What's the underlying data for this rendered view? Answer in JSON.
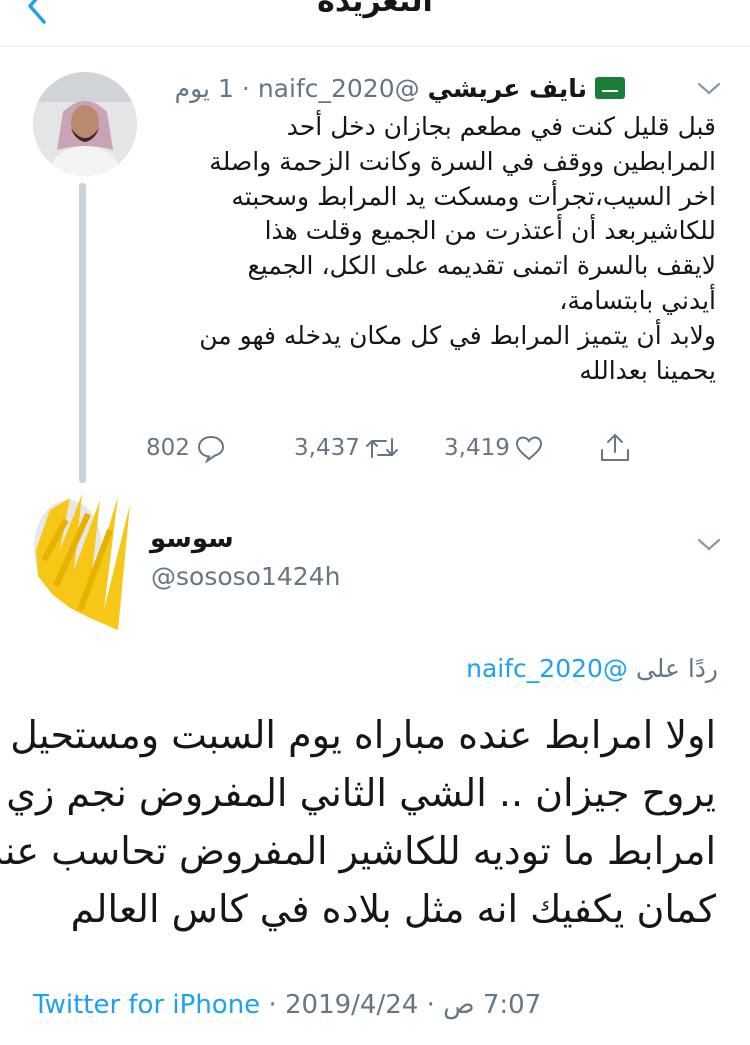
{
  "header": {
    "title": "التغريدة",
    "back_icon": "chevron-left-icon"
  },
  "tweet": {
    "author_name": "نايف عريشي",
    "handle": "@naifc_2020",
    "time": "1 يوم",
    "flag": "saudi-flag-emoji",
    "body_lines": [
      "قبل قليل كنت في مطعم بجازان دخل أحد",
      "المرابطين ووقف في السرة وكانت الزحمة واصلة",
      "اخر السيب،تجرأت ومسكت يد المرابط وسحبته",
      "للكاشيربعد أن أعتذرت من الجميع وقلت هذا",
      "لايقف بالسرة اتمنى تقديمه على الكل، الجميع",
      "أيدني بابتسامة،",
      "ولابد أن يتميز المرابط في كل مكان يدخله فهو من",
      "يحمينا بعدالله"
    ],
    "replies": "802",
    "retweets": "3,437",
    "likes": "3,419"
  },
  "reply": {
    "author_name": "سوسو",
    "handle": "@sososo1424h",
    "reply_prefix": "ردًا على",
    "reply_to": "@naifc_2020",
    "body_lines": [
      "اولا امرابط عنده مباراه يوم السبت ومستحيل",
      "يروح جيزان .. الشي الثاني المفروض نجم زي",
      "امرابط ما توديه للكاشير المفروض تحاسب عنه",
      "كمان يكفيك انه مثل بلاده في كاس العالم"
    ],
    "source": "Twitter for iPhone",
    "date": "2019/4/24",
    "time": "7:07 ص"
  },
  "colors": {
    "accent": "#1da1f2",
    "muted": "#657786",
    "text": "#14171a",
    "thread_line": "#c8d4dd"
  }
}
